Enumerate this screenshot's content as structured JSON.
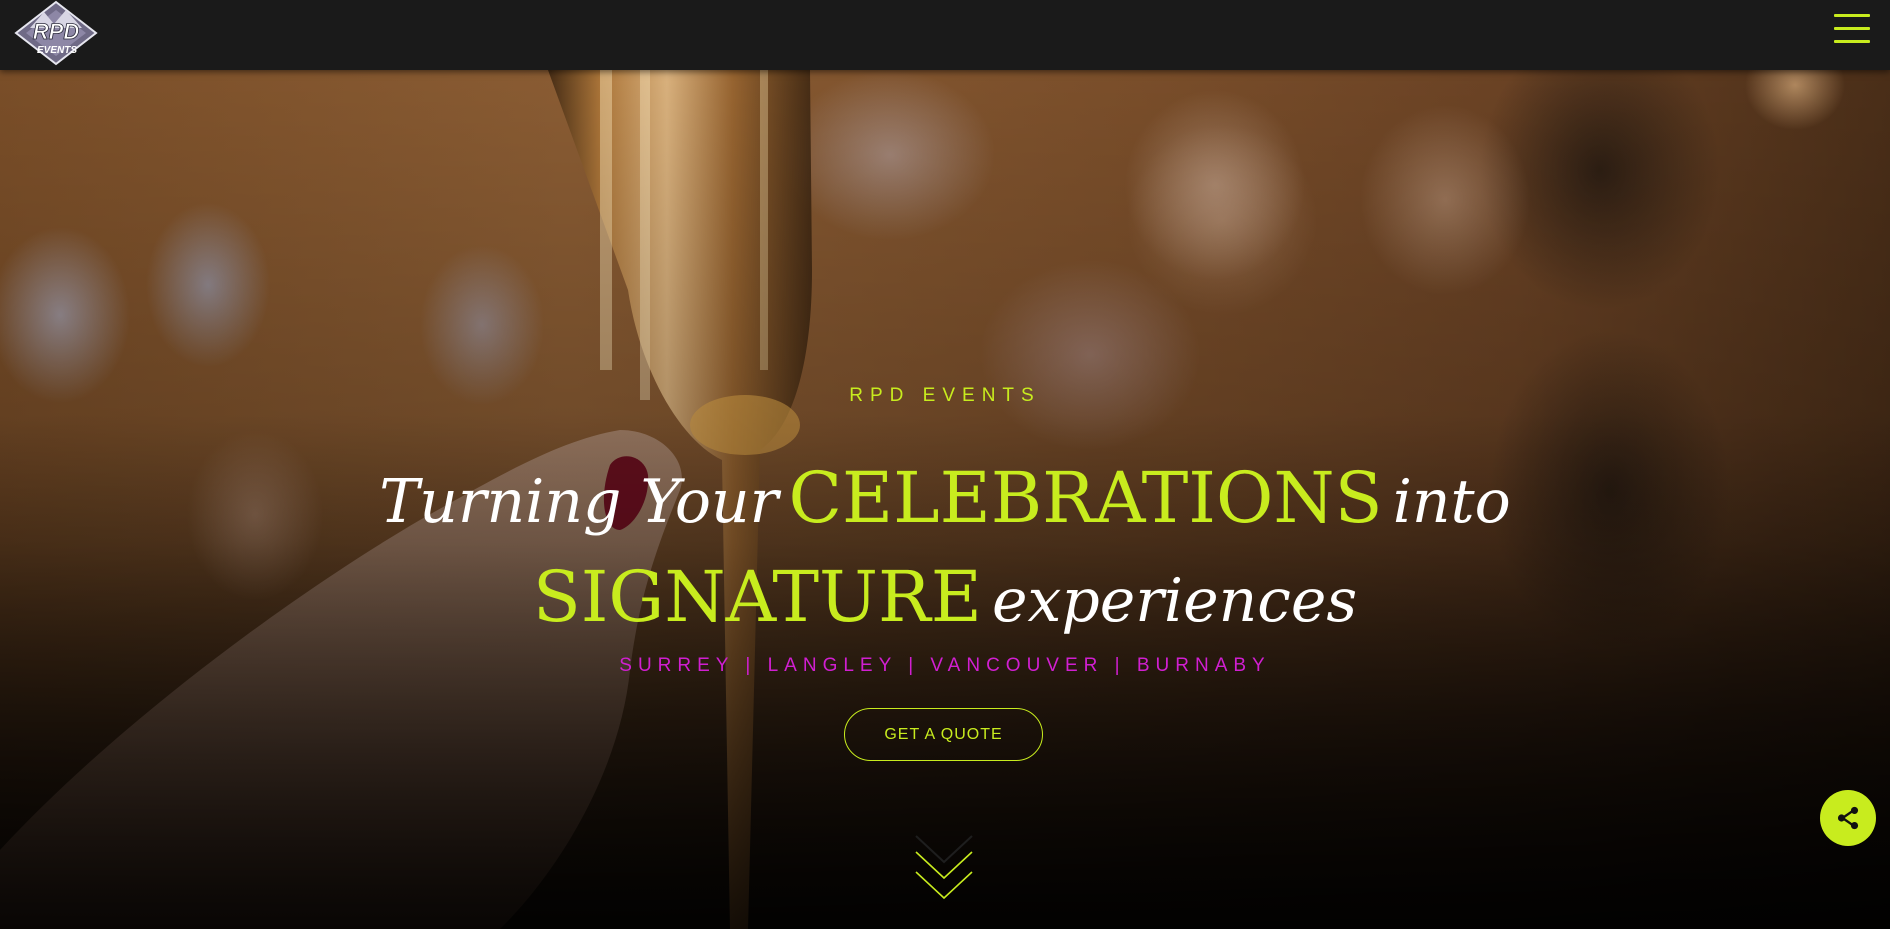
{
  "header": {
    "logo": {
      "name": "RPD EVENTS logo",
      "text_top": "RPD",
      "text_bottom": "EVENTS"
    },
    "menu_icon": "hamburger-menu-icon"
  },
  "hero": {
    "kicker": "RPD EVENTS",
    "headline": {
      "line1_part1": "Turning Your",
      "line1_accent": "CELEBRATIONS",
      "line1_part2": "into",
      "line2_accent": "SIGNATURE",
      "line2_part1": "experiences"
    },
    "locations": "SURREY | LANGLEY | VANCOUVER | BURNABY",
    "cta_label": "GET A QUOTE",
    "scroll_icon": "double-chevron-down-icon"
  },
  "share_icon": "share-icon",
  "colors": {
    "accent": "#c8ec1e",
    "locations": "#d11fd1",
    "header_bg": "#1a1a1a"
  }
}
